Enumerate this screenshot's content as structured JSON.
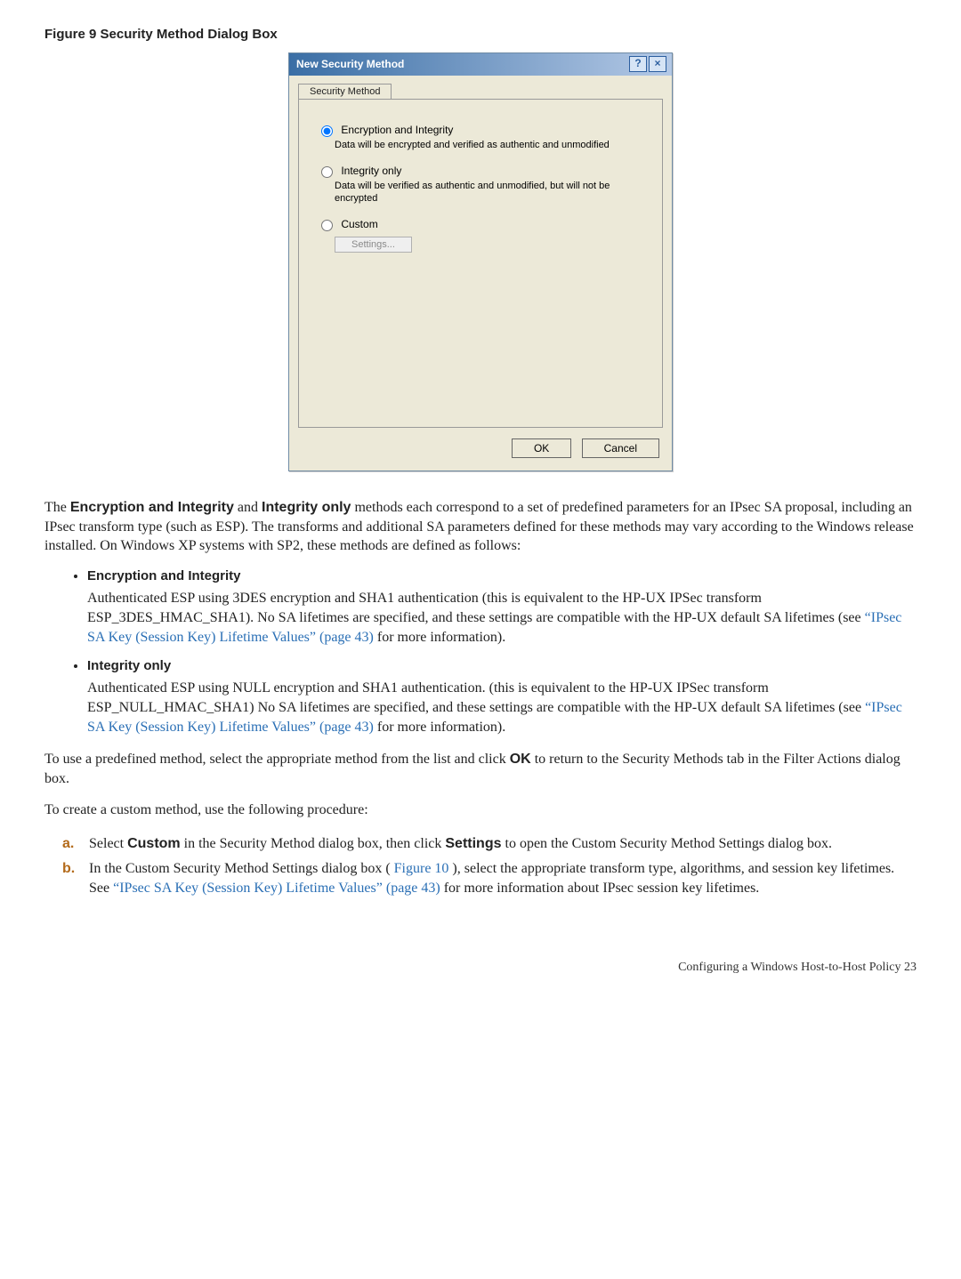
{
  "figure": {
    "caption": "Figure  9  Security Method Dialog Box"
  },
  "dialog": {
    "title": "New Security Method",
    "help_icon": "?",
    "close_icon": "×",
    "tab_label": "Security Method",
    "options": {
      "enc_int": {
        "label": "Encryption and Integrity",
        "hint": "Data will be encrypted and verified as authentic and unmodified"
      },
      "int_only": {
        "label": "Integrity only",
        "hint": "Data will be verified as authentic and unmodified, but will not be encrypted"
      },
      "custom": {
        "label": "Custom",
        "settings_button": "Settings..."
      }
    },
    "buttons": {
      "ok": "OK",
      "cancel": "Cancel"
    }
  },
  "text": {
    "intro_pre": "The ",
    "intro_b1": "Encryption and Integrity",
    "intro_mid1": " and ",
    "intro_b2": "Integrity only",
    "intro_post": " methods each correspond to a set of predefined parameters for an IPsec SA proposal, including an IPsec transform type (such as ESP). The transforms and additional SA parameters defined for these methods may vary according to the Windows release installed. On Windows XP systems with SP2, these methods are defined as follows:",
    "enc_int_heading": "Encryption and Integrity",
    "enc_int_body_pre": "Authenticated ESP using 3DES encryption and SHA1 authentication (this is equivalent to the HP-UX IPSec transform ESP_3DES_HMAC_SHA1). No SA lifetimes are specified, and these settings are compatible with the HP-UX default SA lifetimes (see ",
    "enc_int_link": "“IPsec SA Key (Session Key) Lifetime Values” (page 43)",
    "enc_int_body_post": " for more information).",
    "int_only_heading": "Integrity only",
    "int_only_body_pre": "Authenticated ESP using NULL encryption and SHA1 authentication. (this is equivalent to the HP-UX IPSec transform ESP_NULL_HMAC_SHA1) No SA lifetimes are specified, and these settings are compatible with the HP-UX default SA lifetimes (see ",
    "int_only_link": "“IPsec SA Key (Session Key) Lifetime Values” (page 43)",
    "int_only_body_post": " for more information).",
    "predef_pre": "To use a predefined method, select the appropriate method from the list and click ",
    "predef_b": "OK",
    "predef_post": " to return to the Security Methods tab in the Filter Actions dialog box.",
    "custom_intro": "To create a custom method, use the following procedure:",
    "step_a_pre": "Select ",
    "step_a_b1": "Custom",
    "step_a_mid": " in the Security Method dialog box, then click ",
    "step_a_b2": "Settings",
    "step_a_post": " to open the Custom Security Method Settings dialog box.",
    "step_b_pre": "In the Custom Security Method Settings dialog box (",
    "step_b_link1": "Figure 10",
    "step_b_mid1": "), select the appropriate transform type, algorithms, and session key lifetimes. See ",
    "step_b_link2": "“IPsec SA Key (Session Key) Lifetime Values” (page 43)",
    "step_b_post": " for more information about IPsec session key lifetimes.",
    "footer": "Configuring a Windows Host-to-Host Policy    23"
  }
}
